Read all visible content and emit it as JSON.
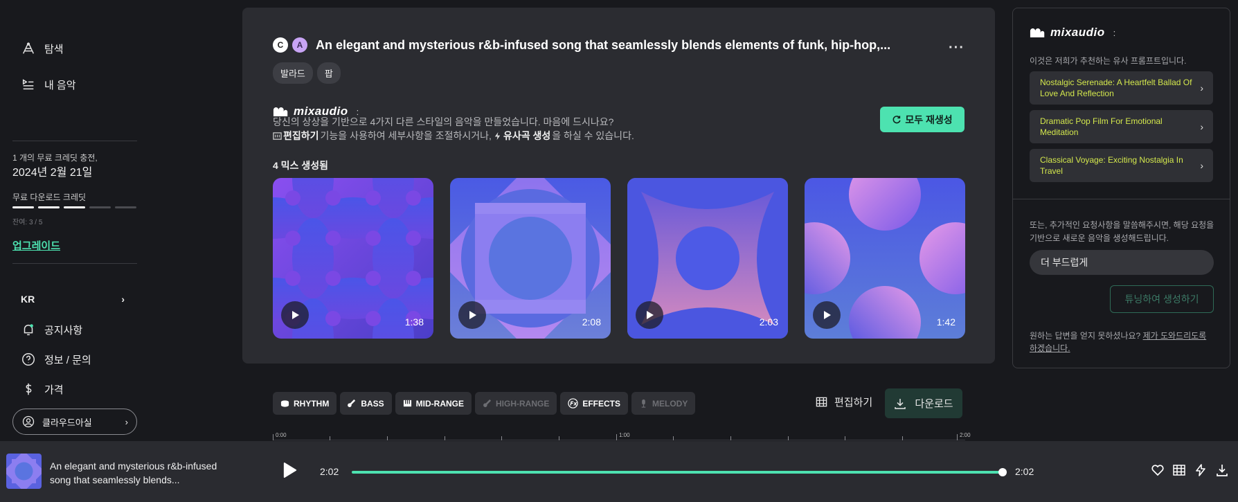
{
  "sidebar": {
    "nav": [
      {
        "label": "탐색",
        "icon": "explore-icon"
      },
      {
        "label": "내 음악",
        "icon": "library-icon"
      }
    ],
    "credit_line": "1 개의 무료 크레딧 충전,",
    "credit_date": "2024년 2월 21일",
    "download_credit_label": "무료 다운로드 크레딧",
    "download_credit_progress": {
      "used": 3,
      "total": 5
    },
    "remaining_text": "잔여: 3 / 5",
    "upgrade": "업그레이드",
    "language": "KR",
    "links": [
      {
        "label": "공지사항",
        "icon": "bell-icon"
      },
      {
        "label": "정보 / 문의",
        "icon": "help-icon"
      },
      {
        "label": "가격",
        "icon": "dollar-icon"
      }
    ],
    "user": "클라우드아실"
  },
  "main": {
    "avatars": [
      "C",
      "A"
    ],
    "title": "An elegant and mysterious r&b-infused song that seamlessly blends elements of funk, hip-hop,...",
    "more": "···",
    "tags": [
      "발라드",
      "팝"
    ],
    "logo": "mixaudio",
    "logo_colon": ":",
    "desc_line1": "당신의 상상을 기반으로 4가지 다른 스타일의 음악을 만들었습니다. 마음에 드시나요?",
    "desc_line2_edit": "편집하기",
    "desc_line2_mid": "기능을 사용하여 세부사항을 조절하시거나,",
    "desc_line2_similar": "유사곡 생성",
    "desc_line2_end": "을 하실 수 있습니다.",
    "regen_label": "모두 재생성",
    "mix_count": "4 믹스 생성됨",
    "tiles": [
      {
        "duration": "1:38"
      },
      {
        "duration": "2:08"
      },
      {
        "duration": "2:03"
      },
      {
        "duration": "1:42"
      }
    ]
  },
  "stems": [
    {
      "label": "RHYTHM",
      "icon": "drum-icon",
      "enabled": true
    },
    {
      "label": "BASS",
      "icon": "bass-icon",
      "enabled": true
    },
    {
      "label": "MID-RANGE",
      "icon": "piano-icon",
      "enabled": true
    },
    {
      "label": "HIGH-RANGE",
      "icon": "guitar-icon",
      "enabled": false
    },
    {
      "label": "EFFECTS",
      "icon": "fx-icon",
      "enabled": true
    },
    {
      "label": "MELODY",
      "icon": "mic-icon",
      "enabled": false
    }
  ],
  "toolbar": {
    "edit_label": "편집하기",
    "download_label": "다운로드"
  },
  "timeline": [
    "0:00",
    "1:00",
    "2:00"
  ],
  "right_panel": {
    "logo": "mixaudio",
    "colon": ":",
    "subtitle": "이것은 저희가 추천하는 유사 프롬프트입니다.",
    "suggestions": [
      "Nostalgic Serenade: A Heartfelt Ballad Of Love And Reflection",
      "Dramatic Pop Film For Emotional Meditation",
      "Classical Voyage: Exciting Nostalgia In Travel"
    ],
    "tune_text": "또는, 추가적인 요청사항을 말씀해주시면, 해당 요청을 기반으로 새로운 음악을 생성해드립니다.",
    "tune_input_value": "더 부드럽게",
    "tune_button": "튜닝하여 생성하기",
    "help_text": "원하는 답변을 얻지 못하셨나요?",
    "help_link": "제가 도와드리도록 하겠습니다."
  },
  "player": {
    "title": "An elegant and mysterious r&b-infused song that seamlessly blends...",
    "current_time": "2:02",
    "total_time": "2:02",
    "progress": 1.0
  },
  "colors": {
    "accent": "#4de2b0",
    "suggest_text": "#d4e84d",
    "card": "#2b2c31"
  }
}
